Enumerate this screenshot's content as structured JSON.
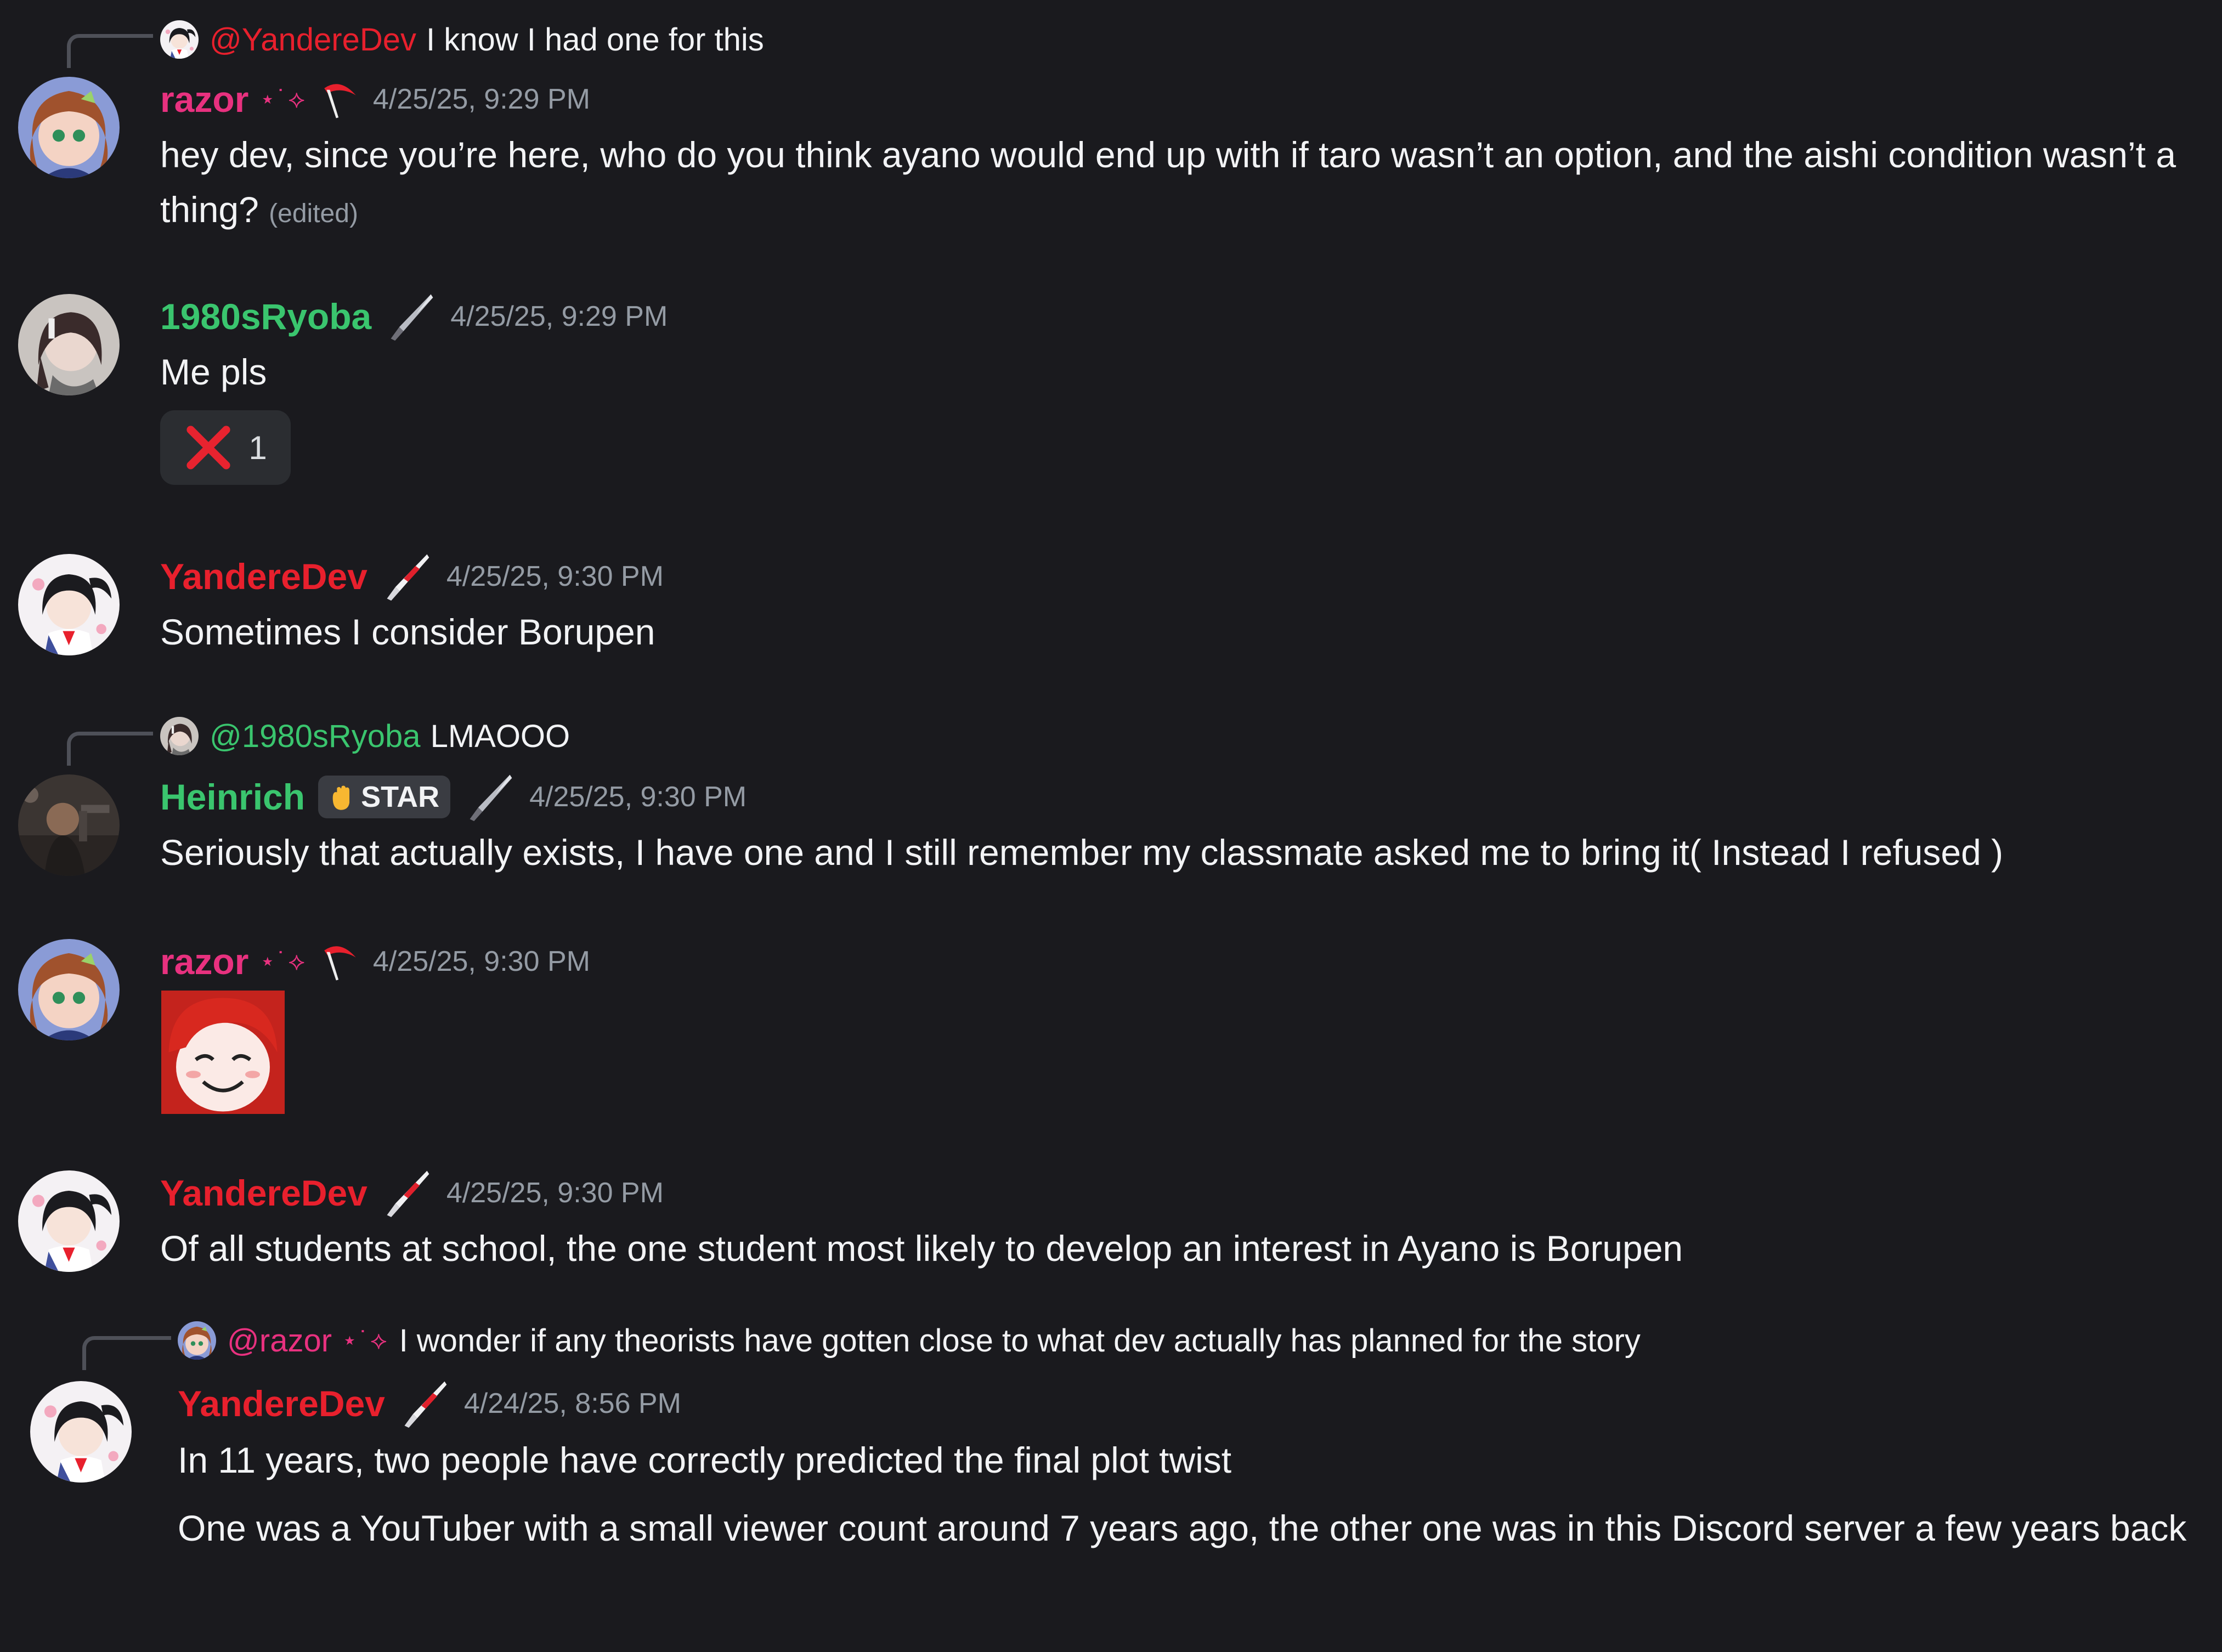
{
  "colors": {
    "background": "#1a1a1e",
    "text": "#f2f3f5",
    "muted": "#949ba4",
    "razor": "#e8317f",
    "ryoba": "#3ac56e",
    "heinrich": "#3ac56e",
    "yanderedev": "#e8202d"
  },
  "messages": [
    {
      "reply": {
        "mention": "@YandereDev",
        "text": "I know I had one for this",
        "avatar_icon": "yanderedev-avatar"
      },
      "username": "razor",
      "decoration": "⋆˙⟡",
      "role_icon": "scythe-icon",
      "timestamp": "4/25/25, 9:29 PM",
      "text": "hey dev, since you’re here, who do you think ayano would end up with if taro wasn’t an option, and the aishi condition wasn’t a thing?",
      "edited": "(edited)"
    },
    {
      "username": "1980sRyoba",
      "role_icon": "knife-icon",
      "timestamp": "4/25/25, 9:29 PM",
      "text": "Me pls",
      "reaction": {
        "icon": "cross-mark-icon",
        "count": "1"
      }
    },
    {
      "username": "YandereDev",
      "role_icon": "bloody-knife-icon",
      "timestamp": "4/25/25, 9:30 PM",
      "text": "Sometimes I consider Borupen"
    },
    {
      "reply": {
        "mention": "@1980sRyoba",
        "text": "LMAOOO",
        "avatar_icon": "ryoba-avatar"
      },
      "username": "Heinrich",
      "badge": "STAR",
      "role_icon": "knife-icon",
      "timestamp": "4/25/25, 9:30 PM",
      "text": "Seriously that actually exists, I have one and I still remember my classmate asked me to bring it( Instead I refused )"
    },
    {
      "username": "razor",
      "decoration": "⋆˙⟡",
      "role_icon": "scythe-icon",
      "timestamp": "4/25/25, 9:30 PM",
      "sticker": "smiling-redhead-sticker"
    },
    {
      "username": "YandereDev",
      "role_icon": "bloody-knife-icon",
      "timestamp": "4/25/25, 9:30 PM",
      "text": "Of all students at school, the one student most likely to develop an interest in Ayano is Borupen"
    },
    {
      "reply": {
        "mention": "@razor",
        "decoration": "⋆˙⟡",
        "text": "I wonder if any theorists have gotten close to what dev actually has planned for the story",
        "avatar_icon": "razor-avatar"
      },
      "username": "YandereDev",
      "role_icon": "bloody-knife-icon",
      "timestamp": "4/24/25, 8:56 PM",
      "text": "In 11 years, two people have correctly predicted the final plot twist",
      "text2": "One was a YouTuber with a small viewer count around 7 years ago, the other one was in this Discord server a few years back"
    }
  ]
}
